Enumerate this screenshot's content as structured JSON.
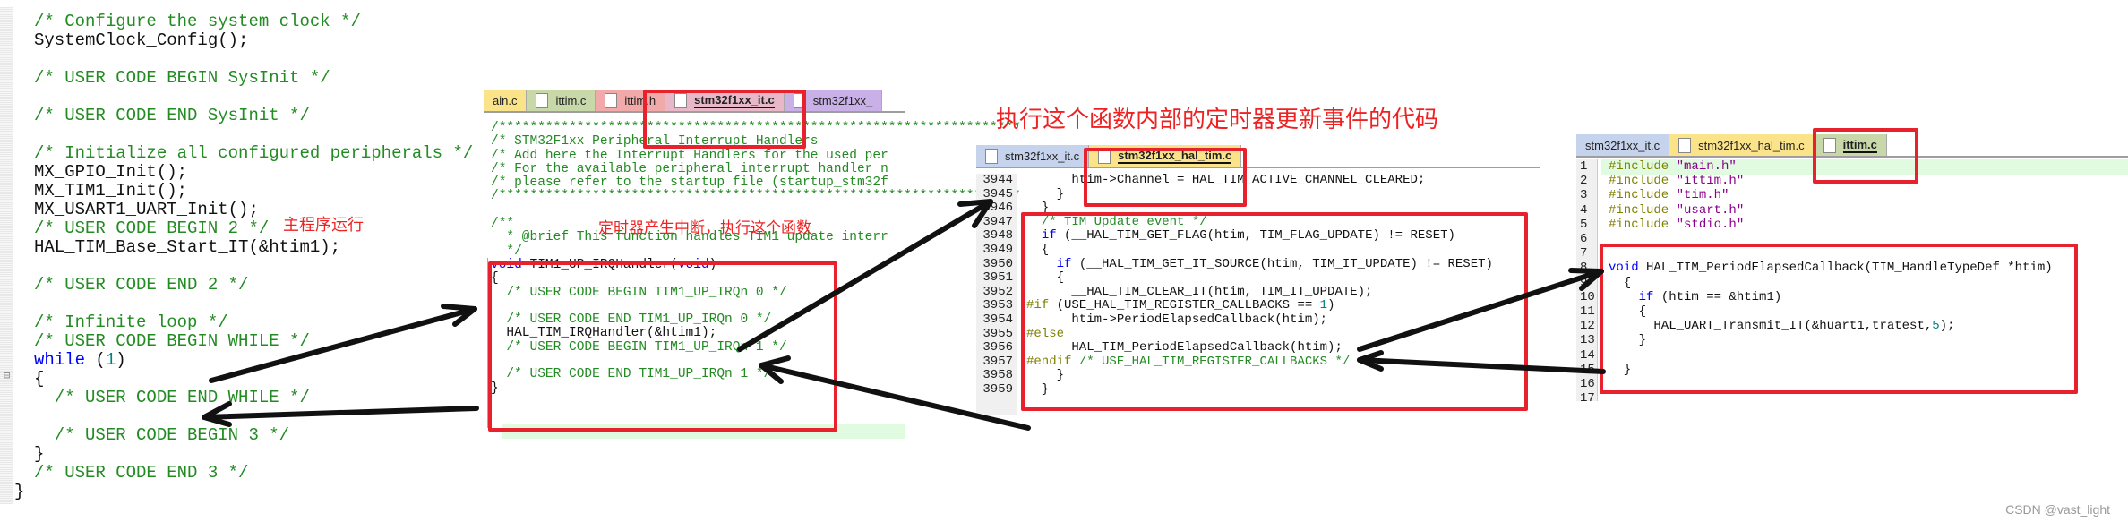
{
  "main_c": {
    "lines": [
      [
        {
          "t": "/* Configure the system clock */",
          "c": "cm"
        }
      ],
      [
        {
          "t": "SystemClock_Config();",
          "c": "tx"
        }
      ],
      [],
      [
        {
          "t": "/* USER CODE BEGIN SysInit */",
          "c": "cm"
        }
      ],
      [],
      [
        {
          "t": "/* USER CODE END SysInit */",
          "c": "cm"
        }
      ],
      [],
      [
        {
          "t": "/* Initialize all configured peripherals */",
          "c": "cm"
        }
      ],
      [
        {
          "t": "MX_GPIO_Init();",
          "c": "tx"
        }
      ],
      [
        {
          "t": "MX_TIM1_Init();",
          "c": "tx"
        }
      ],
      [
        {
          "t": "MX_USART1_UART_Init();",
          "c": "tx"
        }
      ],
      [
        {
          "t": "/* USER CODE BEGIN 2 */",
          "c": "cm"
        }
      ],
      [
        {
          "t": "HAL_TIM_Base_Start_IT(&htim1);",
          "c": "tx"
        }
      ],
      [],
      [
        {
          "t": "/* USER CODE END 2 */",
          "c": "cm"
        }
      ],
      [],
      [
        {
          "t": "/* Infinite loop */",
          "c": "cm"
        }
      ],
      [
        {
          "t": "/* USER CODE BEGIN WHILE */",
          "c": "cm"
        }
      ],
      [
        {
          "t": "while",
          "c": "kw"
        },
        {
          "t": " (",
          "c": "tx"
        },
        {
          "t": "1",
          "c": "num"
        },
        {
          "t": ")",
          "c": "tx"
        }
      ],
      [
        {
          "t": "{",
          "c": "tx"
        }
      ],
      [
        {
          "t": "  /* USER CODE END WHILE */",
          "c": "cm"
        }
      ],
      [],
      [
        {
          "t": "  /* USER CODE BEGIN 3 */",
          "c": "cm"
        }
      ],
      [
        {
          "t": "}",
          "c": "tx"
        }
      ],
      [
        {
          "t": "/* USER CODE END 3 */",
          "c": "cm"
        }
      ],
      [
        {
          "t": "}",
          "c": "tx",
          "outdent": true
        }
      ]
    ]
  },
  "it_c": {
    "tabs": [
      {
        "label": "ain.c",
        "color": "#fbe38a",
        "active": false,
        "icon": false
      },
      {
        "label": "ittim.c",
        "color": "#c8d8a8",
        "active": false,
        "icon": true
      },
      {
        "label": "ittim.h",
        "color": "#f2a9a9",
        "active": false,
        "icon": true
      },
      {
        "label": "stm32f1xx_it.c",
        "color": "#e8b8c8",
        "active": true,
        "icon": true
      },
      {
        "label": "stm32f1xx_",
        "color": "#c9b0e6",
        "active": false,
        "icon": true
      }
    ],
    "lines": [
      [
        {
          "t": "/*******************************************************************",
          "c": "cm"
        }
      ],
      [
        {
          "t": "/* STM32F1xx Peripheral Interrupt Handlers",
          "c": "cm"
        }
      ],
      [
        {
          "t": "/* Add here the Interrupt Handlers for the used per",
          "c": "cm"
        }
      ],
      [
        {
          "t": "/* For the available peripheral interrupt handler n",
          "c": "cm"
        }
      ],
      [
        {
          "t": "/* please refer to the startup file (startup_stm32f",
          "c": "cm"
        }
      ],
      [
        {
          "t": "/*******************************************************************",
          "c": "cm"
        }
      ],
      [],
      [
        {
          "t": "/**",
          "c": "cm"
        }
      ],
      [
        {
          "t": "  * @brief This function handles TIM1 update interr",
          "c": "cm"
        }
      ],
      [
        {
          "t": "  */",
          "c": "cm"
        }
      ],
      [
        {
          "t": "void",
          "c": "kw"
        },
        {
          "t": " TIM1_UP_IRQHandler(",
          "c": "tx"
        },
        {
          "t": "void",
          "c": "kw"
        },
        {
          "t": ")",
          "c": "tx"
        }
      ],
      [
        {
          "t": "{",
          "c": "tx"
        }
      ],
      [
        {
          "t": "  /* USER CODE BEGIN TIM1_UP_IRQn 0 */",
          "c": "cm"
        }
      ],
      [],
      [
        {
          "t": "  /* USER CODE END TIM1_UP_IRQn 0 */",
          "c": "cm"
        }
      ],
      [
        {
          "t": "  HAL_TIM_IRQHandler(&htim1);",
          "c": "tx"
        }
      ],
      [
        {
          "t": "  /* USER CODE BEGIN TIM1_UP_IRQn 1 */",
          "c": "cm"
        }
      ],
      [],
      [
        {
          "t": "  /* USER CODE END TIM1_UP_IRQn 1 */",
          "c": "cm"
        }
      ],
      [
        {
          "t": "}",
          "c": "tx"
        }
      ]
    ]
  },
  "hal_tim_c": {
    "tabs": [
      {
        "label": "stm32f1xx_it.c",
        "color": "#c5d3ec",
        "active": false,
        "icon": true
      },
      {
        "label": "stm32f1xx_hal_tim.c",
        "color": "#fbe38a",
        "active": true,
        "icon": true
      }
    ],
    "line_numbers": [
      "3944",
      "3945",
      "3946",
      "3947",
      "3948",
      "3949",
      "3950",
      "3951",
      "3952",
      "3953",
      "3954",
      "3955",
      "3956",
      "3957",
      "3958",
      "3959"
    ],
    "lines": [
      [
        {
          "t": "      htim->Channel = HAL_TIM_ACTIVE_CHANNEL_CLEARED;",
          "c": "tx"
        }
      ],
      [
        {
          "t": "    }",
          "c": "tx"
        }
      ],
      [
        {
          "t": "  }",
          "c": "tx"
        }
      ],
      [
        {
          "t": "  /* TIM Update event */",
          "c": "cm"
        }
      ],
      [
        {
          "t": "  ",
          "c": "tx"
        },
        {
          "t": "if",
          "c": "kw"
        },
        {
          "t": " (__HAL_TIM_GET_FLAG(htim, TIM_FLAG_UPDATE) != RESET)",
          "c": "tx"
        }
      ],
      [
        {
          "t": "  {",
          "c": "tx"
        }
      ],
      [
        {
          "t": "    ",
          "c": "tx"
        },
        {
          "t": "if",
          "c": "kw"
        },
        {
          "t": " (__HAL_TIM_GET_IT_SOURCE(htim, TIM_IT_UPDATE) != RESET)",
          "c": "tx"
        }
      ],
      [
        {
          "t": "    {",
          "c": "tx"
        }
      ],
      [
        {
          "t": "      __HAL_TIM_CLEAR_IT(htim, TIM_IT_UPDATE);",
          "c": "tx"
        }
      ],
      [
        {
          "t": "#if",
          "c": "pp"
        },
        {
          "t": " (USE_HAL_TIM_REGISTER_CALLBACKS == ",
          "c": "tx"
        },
        {
          "t": "1",
          "c": "num"
        },
        {
          "t": ")",
          "c": "tx"
        }
      ],
      [
        {
          "t": "      htim->PeriodElapsedCallback(htim);",
          "c": "tx"
        }
      ],
      [
        {
          "t": "#else",
          "c": "pp"
        }
      ],
      [
        {
          "t": "      HAL_TIM_PeriodElapsedCallback(htim);",
          "c": "tx"
        }
      ],
      [
        {
          "t": "#endif",
          "c": "pp"
        },
        {
          "t": " /* USE_HAL_TIM_REGISTER_CALLBACKS */",
          "c": "cm"
        }
      ],
      [
        {
          "t": "    }",
          "c": "tx"
        }
      ],
      [
        {
          "t": "  }",
          "c": "tx"
        }
      ]
    ]
  },
  "ittim_c": {
    "tabs": [
      {
        "label": "stm32f1xx_it.c",
        "color": "#c5d3ec",
        "active": false,
        "icon": false
      },
      {
        "label": "stm32f1xx_hal_tim.c",
        "color": "#fbe38a",
        "active": false,
        "icon": true
      },
      {
        "label": "ittim.c",
        "color": "#c8d8a8",
        "active": true,
        "icon": true
      }
    ],
    "line_numbers": [
      "1",
      "2",
      "3",
      "4",
      "5",
      "6",
      "7",
      "8",
      "9",
      "10",
      "11",
      "12",
      "13",
      "14",
      "15",
      "16",
      "17"
    ],
    "lines": [
      [
        {
          "t": "#include ",
          "c": "pp"
        },
        {
          "t": "\"main.h\"",
          "c": "str"
        }
      ],
      [
        {
          "t": "#include ",
          "c": "pp"
        },
        {
          "t": "\"ittim.h\"",
          "c": "str"
        }
      ],
      [
        {
          "t": "#include ",
          "c": "pp"
        },
        {
          "t": "\"tim.h\"",
          "c": "str"
        }
      ],
      [
        {
          "t": "#include ",
          "c": "pp"
        },
        {
          "t": "\"usart.h\"",
          "c": "str"
        }
      ],
      [
        {
          "t": "#include ",
          "c": "pp"
        },
        {
          "t": "\"stdio.h\"",
          "c": "str"
        }
      ],
      [],
      [],
      [
        {
          "t": "void",
          "c": "kw"
        },
        {
          "t": " HAL_TIM_PeriodElapsedCallback(TIM_HandleTypeDef *htim)",
          "c": "tx"
        }
      ],
      [
        {
          "t": "  {",
          "c": "tx"
        }
      ],
      [
        {
          "t": "    ",
          "c": "tx"
        },
        {
          "t": "if",
          "c": "kw"
        },
        {
          "t": " (htim == &htim1)",
          "c": "tx"
        }
      ],
      [
        {
          "t": "    {",
          "c": "tx"
        }
      ],
      [
        {
          "t": "      HAL_UART_Transmit_IT(&huart1,tratest,",
          "c": "tx"
        },
        {
          "t": "5",
          "c": "num"
        },
        {
          "t": ");",
          "c": "tx"
        }
      ],
      [
        {
          "t": "    }",
          "c": "tx"
        }
      ],
      [],
      [
        {
          "t": "  }",
          "c": "tx"
        }
      ],
      [],
      []
    ]
  },
  "annotations": {
    "main_running": "主程序运行",
    "timer_interrupt": "定时器产生中断，执行这个函数",
    "update_event": "执行这个函数内部的定时器更新事件的代码"
  },
  "watermark": "CSDN @vast_light",
  "colors": {
    "highlight_red": "#e8222c",
    "annotation_red": "#ee2222",
    "arrow": "#111111"
  }
}
